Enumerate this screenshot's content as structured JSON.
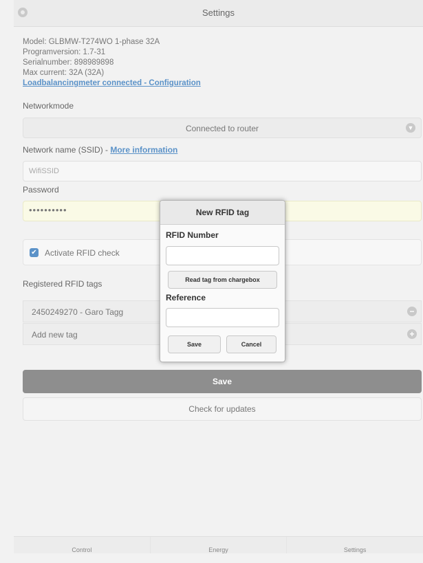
{
  "header": {
    "title": "Settings"
  },
  "info": {
    "model": "Model: GLBMW-T274WO 1-phase 32A",
    "program_version": "Programversion: 1.7-31",
    "serial_number": "Serialnumber: 898989898",
    "max_current": "Max current: 32A (32A)",
    "loadbalancing_link": "Loadbalancingmeter connected - Configuration"
  },
  "network": {
    "mode_label": "Networkmode",
    "mode_value": "Connected to router",
    "ssid_label": "Network name (SSID) - ",
    "ssid_more_link": "More information",
    "ssid_value": "WifiSSID",
    "password_label": "Password",
    "password_value": "••••••••••"
  },
  "rfid": {
    "activate_label": "Activate RFID check",
    "activate_checked": true,
    "registered_label": "Registered RFID tags",
    "tags": [
      {
        "label": "2450249270 - Garo Tagg",
        "action_icon": "minus-circle-icon"
      }
    ],
    "add_label": "Add new tag",
    "add_icon": "plus-circle-icon"
  },
  "actions": {
    "save_label": "Save",
    "updates_label": "Check for updates"
  },
  "tabs": [
    {
      "label": "Control"
    },
    {
      "label": "Energy"
    },
    {
      "label": "Settings"
    }
  ],
  "dialog": {
    "title": "New RFID tag",
    "rfid_number_label": "RFID Number",
    "read_tag_button": "Read tag from chargebox",
    "reference_label": "Reference",
    "save_button": "Save",
    "cancel_button": "Cancel"
  },
  "colors": {
    "link": "#5b92c8",
    "save_button_bg": "#8e8e8e",
    "password_field_bg": "#fafae6"
  }
}
